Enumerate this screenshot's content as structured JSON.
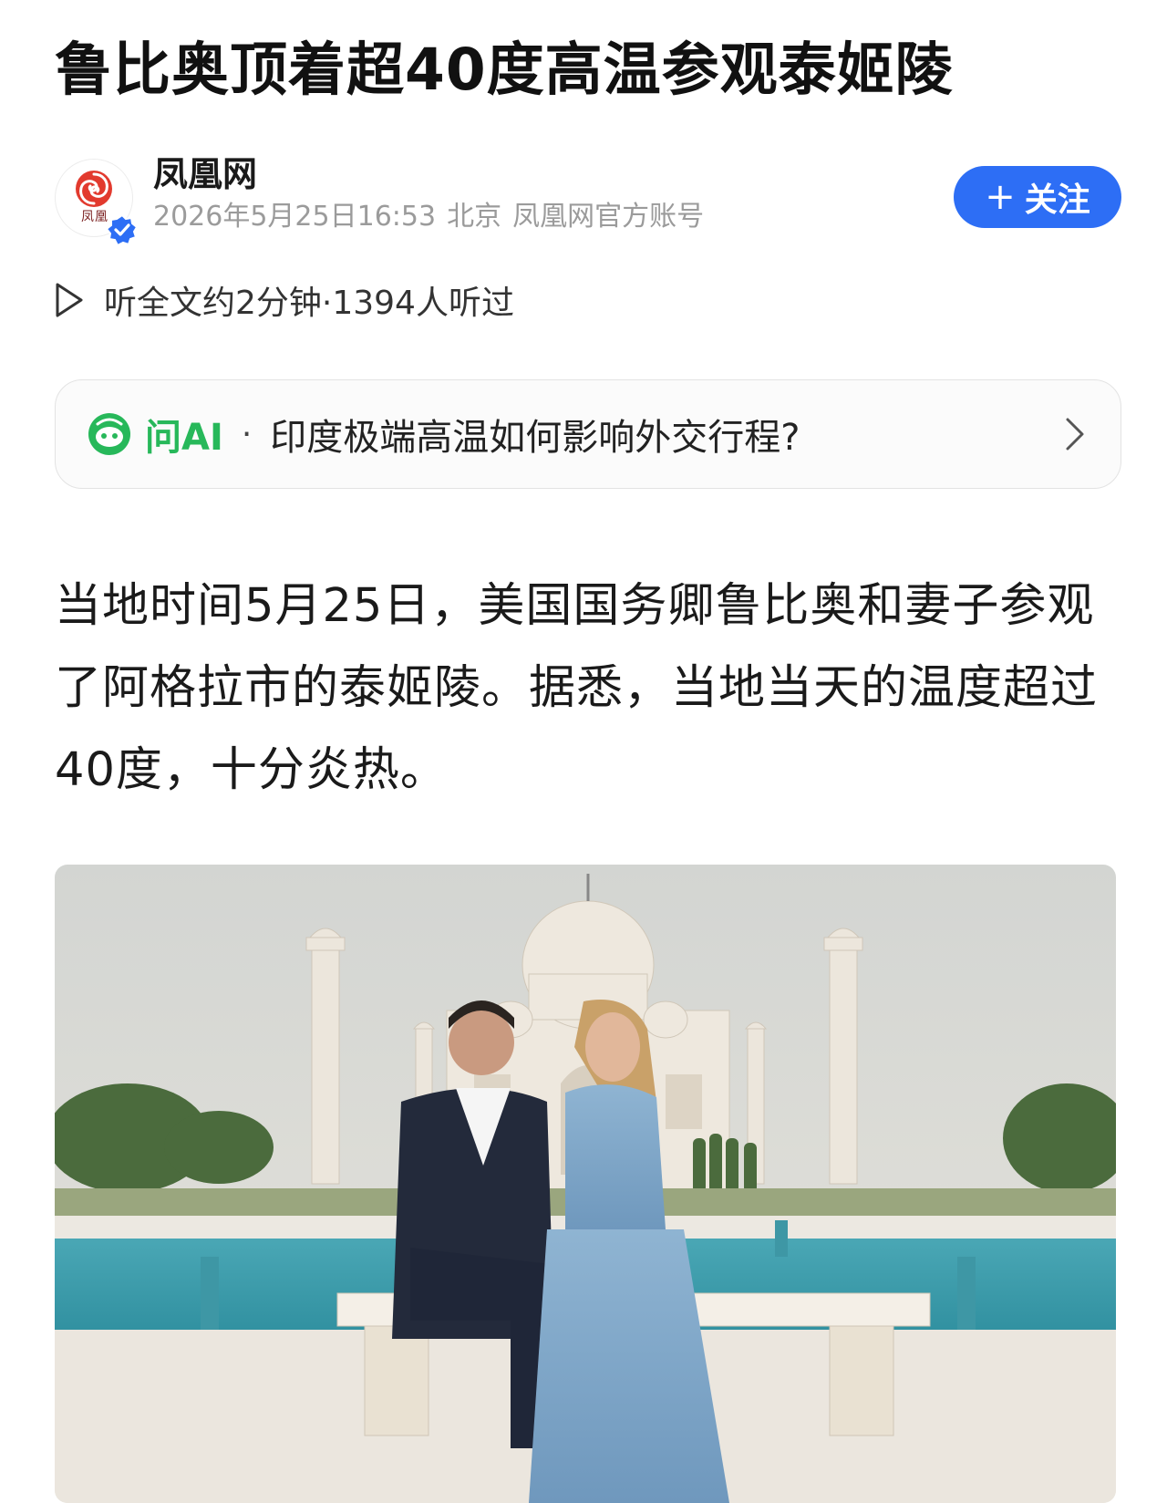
{
  "article": {
    "title": "鲁比奥顶着超40度高温参观泰姬陵",
    "paragraph": "当地时间5月25日，美国国务卿鲁比奥和妻子参观了阿格拉市的泰姬陵。据悉，当地当天的温度超过40度，十分炎热。"
  },
  "author": {
    "name": "凤凰网",
    "logo_text": "凤凰",
    "date_time": "2026年5月25日16:53",
    "location": "北京",
    "account_type": "凤凰网官方账号",
    "verified_icon": "verified-badge-icon",
    "follow_label": "关注",
    "follow_icon": "+"
  },
  "listen": {
    "icon": "play-icon",
    "text": "听全文约2分钟·1394人听过"
  },
  "ask_ai": {
    "label": "问AI",
    "separator": "·",
    "question": "印度极端高温如何影响外交行程?"
  },
  "colors": {
    "accent_blue": "#2d6ef5",
    "ai_green": "#27b85a",
    "meta_gray": "#9b9b9b"
  },
  "photo": {
    "icon": "article-photo"
  }
}
